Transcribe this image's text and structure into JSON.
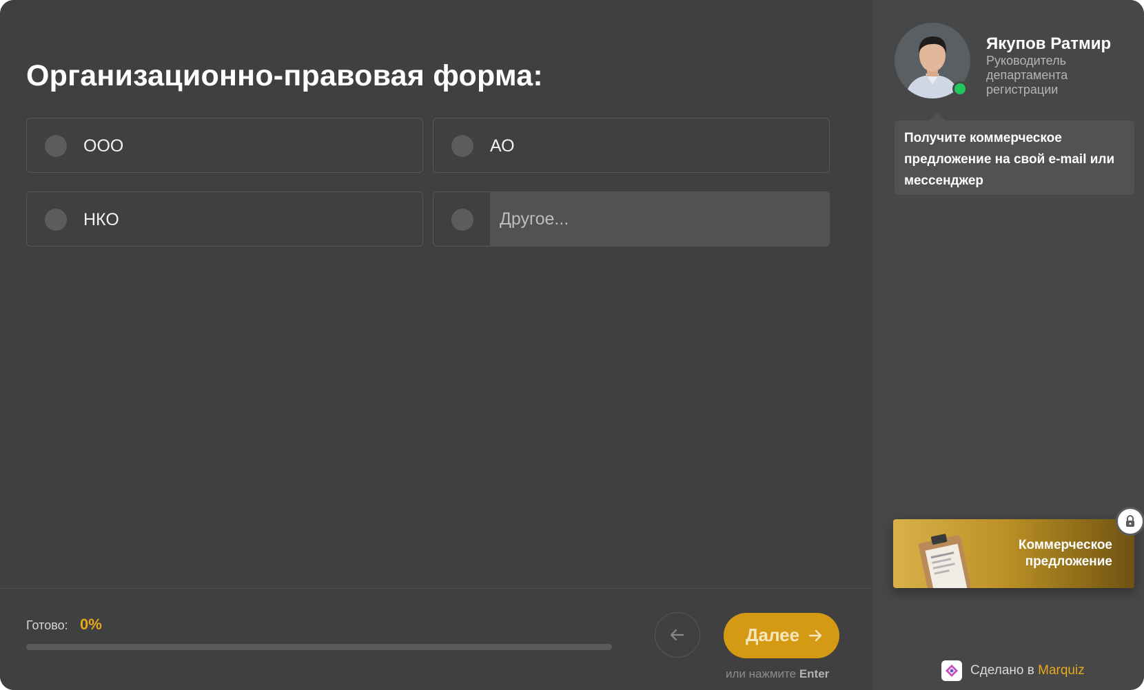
{
  "question": {
    "title": "Организационно-правовая форма:"
  },
  "options": [
    {
      "label": "ООО"
    },
    {
      "label": "АО"
    },
    {
      "label": "НКО"
    }
  ],
  "other_option": {
    "placeholder": "Другое..."
  },
  "progress": {
    "label": "Готово:",
    "value_text": "0%",
    "fraction": 0
  },
  "navigation": {
    "back_icon": "arrow-left-icon",
    "next_label": "Далее",
    "next_icon": "arrow-right-icon",
    "hint_prefix": "или нажмите",
    "hint_key": "Enter"
  },
  "manager": {
    "name": "Якупов Ратмир",
    "role": "Руководитель департамента регистрации",
    "status": "online"
  },
  "bubble": {
    "text": "Получите коммерческое предложение на свой e-mail или мессенджер"
  },
  "offer": {
    "line1": "Коммерческое",
    "line2": "предложение",
    "icon": "clipboard-document-icon",
    "lock_icon": "lock-icon"
  },
  "branding": {
    "prefix": "Сделано в",
    "name": "Marquiz"
  },
  "colors": {
    "background": "#404040",
    "sidebar": "#474747",
    "accent": "#e9a91c",
    "button": "#d49a13",
    "online": "#22c55e"
  }
}
